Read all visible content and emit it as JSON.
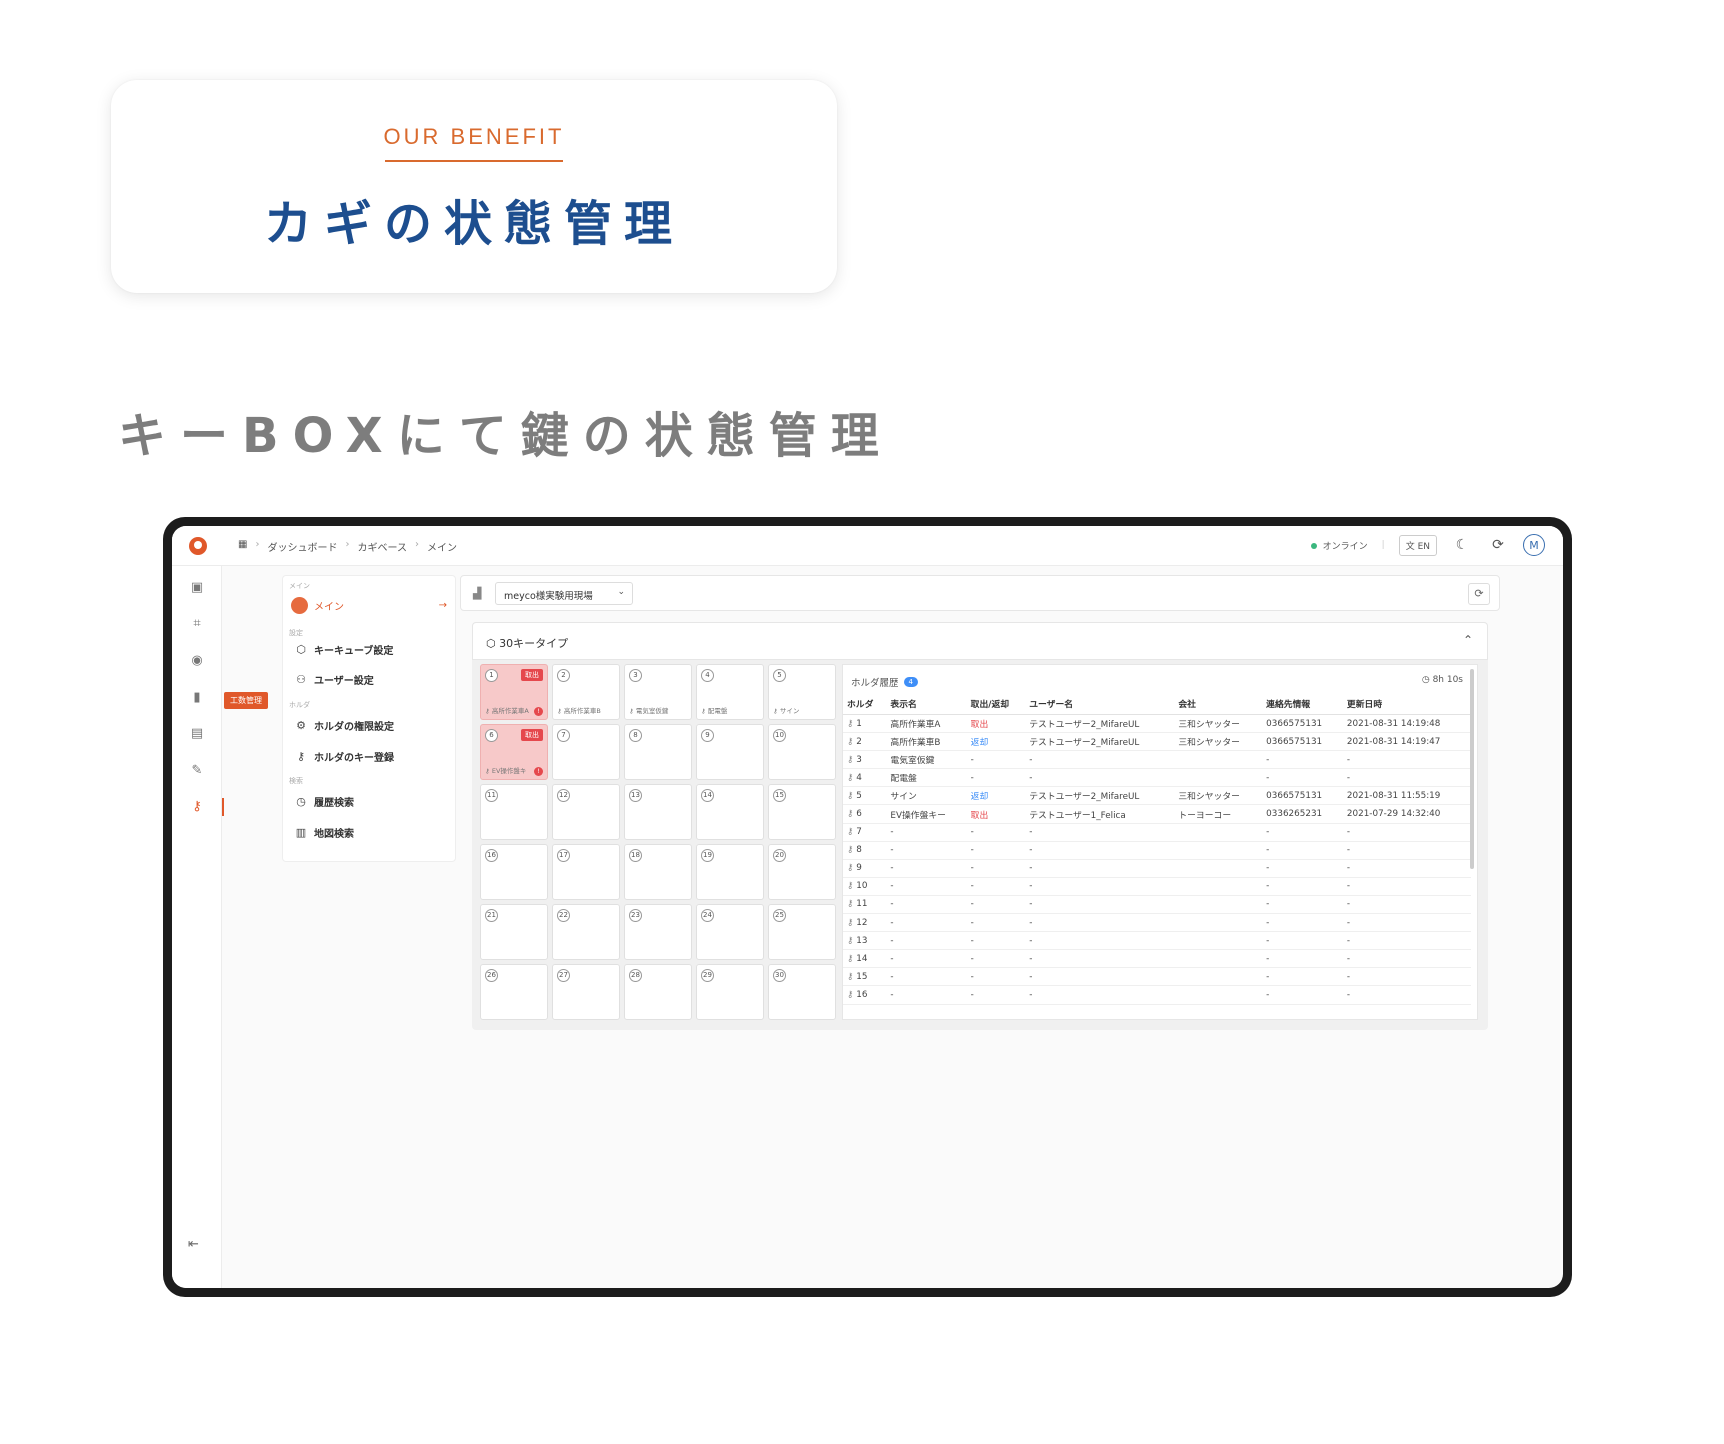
{
  "hero": {
    "eyebrow": "OUR BENEFIT",
    "title": "カギの状態管理",
    "subtitle": "キーBOXにて鍵の状態管理"
  },
  "app": {
    "breadcrumbs": [
      "ダッシュボード",
      "カギベース",
      "メイン"
    ],
    "status": "オンライン",
    "lang": "EN",
    "avatar": "M",
    "tooltip": "工数管理",
    "rail_icons": [
      "dashboard-icon",
      "scan-icon",
      "location-pin-icon",
      "bar-chart-icon",
      "archive-icon",
      "edit-icon",
      "key-icon",
      "logout-icon"
    ],
    "side_menu": {
      "section_main": "メイン",
      "main_item": "メイン",
      "section_settings": "設定",
      "section_holder": "ホルダ",
      "section_search": "検索",
      "items": [
        {
          "label": "キーキューブ設定",
          "icon": "cube-icon"
        },
        {
          "label": "ユーザー設定",
          "icon": "user-icon"
        },
        {
          "label": "ホルダの権限設定",
          "icon": "gear-icon"
        },
        {
          "label": "ホルダのキー登録",
          "icon": "key-icon"
        },
        {
          "label": "履歴検索",
          "icon": "clock-icon"
        },
        {
          "label": "地図検索",
          "icon": "map-icon"
        }
      ]
    },
    "site_select": "meyco様実験用現場",
    "panel_title": "30キータイプ",
    "keys": [
      {
        "num": "1",
        "label": "高所作業車A",
        "status": "out",
        "badge": "取出"
      },
      {
        "num": "2",
        "label": "高所作業車B",
        "status": "in",
        "badge": ""
      },
      {
        "num": "3",
        "label": "電気室仮鍵",
        "status": "in",
        "badge": ""
      },
      {
        "num": "4",
        "label": "配電盤",
        "status": "in",
        "badge": ""
      },
      {
        "num": "5",
        "label": "サイン",
        "status": "in",
        "badge": ""
      },
      {
        "num": "6",
        "label": "EV操作盤キ",
        "status": "out",
        "badge": "取出"
      },
      {
        "num": "7",
        "label": "",
        "status": "in",
        "badge": ""
      },
      {
        "num": "8",
        "label": "",
        "status": "in",
        "badge": ""
      },
      {
        "num": "9",
        "label": "",
        "status": "in",
        "badge": ""
      },
      {
        "num": "10",
        "label": "",
        "status": "in",
        "badge": ""
      },
      {
        "num": "11",
        "label": "",
        "status": "in",
        "badge": ""
      },
      {
        "num": "12",
        "label": "",
        "status": "in",
        "badge": ""
      },
      {
        "num": "13",
        "label": "",
        "status": "in",
        "badge": ""
      },
      {
        "num": "14",
        "label": "",
        "status": "in",
        "badge": ""
      },
      {
        "num": "15",
        "label": "",
        "status": "in",
        "badge": ""
      },
      {
        "num": "16",
        "label": "",
        "status": "in",
        "badge": ""
      },
      {
        "num": "17",
        "label": "",
        "status": "in",
        "badge": ""
      },
      {
        "num": "18",
        "label": "",
        "status": "in",
        "badge": ""
      },
      {
        "num": "19",
        "label": "",
        "status": "in",
        "badge": ""
      },
      {
        "num": "20",
        "label": "",
        "status": "in",
        "badge": ""
      },
      {
        "num": "21",
        "label": "",
        "status": "in",
        "badge": ""
      },
      {
        "num": "22",
        "label": "",
        "status": "in",
        "badge": ""
      },
      {
        "num": "23",
        "label": "",
        "status": "in",
        "badge": ""
      },
      {
        "num": "24",
        "label": "",
        "status": "in",
        "badge": ""
      },
      {
        "num": "25",
        "label": "",
        "status": "in",
        "badge": ""
      },
      {
        "num": "26",
        "label": "",
        "status": "in",
        "badge": ""
      },
      {
        "num": "27",
        "label": "",
        "status": "in",
        "badge": ""
      },
      {
        "num": "28",
        "label": "",
        "status": "in",
        "badge": ""
      },
      {
        "num": "29",
        "label": "",
        "status": "in",
        "badge": ""
      },
      {
        "num": "30",
        "label": "",
        "status": "in",
        "badge": ""
      }
    ],
    "holder_history": {
      "title": "ホルダ履歴",
      "count": "4",
      "timer": "8h 10s",
      "columns": [
        "ホルダ",
        "表示名",
        "取出/返却",
        "ユーザー名",
        "会社",
        "連絡先情報",
        "更新日時"
      ],
      "rows": [
        {
          "holder": "1",
          "name": "高所作業車A",
          "status": "取出",
          "status_type": "out",
          "user": "テストユーザー2_MifareUL",
          "company": "三和シヤッター",
          "contact": "0366575131",
          "updated": "2021-08-31 14:19:48"
        },
        {
          "holder": "2",
          "name": "高所作業車B",
          "status": "返却",
          "status_type": "back",
          "user": "テストユーザー2_MifareUL",
          "company": "三和シヤッター",
          "contact": "0366575131",
          "updated": "2021-08-31 14:19:47"
        },
        {
          "holder": "3",
          "name": "電気室仮鍵",
          "status": "-",
          "status_type": "",
          "user": "-",
          "company": "",
          "contact": "-",
          "updated": "-"
        },
        {
          "holder": "4",
          "name": "配電盤",
          "status": "-",
          "status_type": "",
          "user": "-",
          "company": "",
          "contact": "-",
          "updated": "-"
        },
        {
          "holder": "5",
          "name": "サイン",
          "status": "返却",
          "status_type": "back",
          "user": "テストユーザー2_MifareUL",
          "company": "三和シヤッター",
          "contact": "0366575131",
          "updated": "2021-08-31 11:55:19"
        },
        {
          "holder": "6",
          "name": "EV操作盤キー",
          "status": "取出",
          "status_type": "out",
          "user": "テストユーザー1_Felica",
          "company": "トーヨーコー",
          "contact": "0336265231",
          "updated": "2021-07-29 14:32:40"
        },
        {
          "holder": "7",
          "name": "-",
          "status": "-",
          "status_type": "",
          "user": "-",
          "company": "",
          "contact": "-",
          "updated": "-"
        },
        {
          "holder": "8",
          "name": "-",
          "status": "-",
          "status_type": "",
          "user": "-",
          "company": "",
          "contact": "-",
          "updated": "-"
        },
        {
          "holder": "9",
          "name": "-",
          "status": "-",
          "status_type": "",
          "user": "-",
          "company": "",
          "contact": "-",
          "updated": "-"
        },
        {
          "holder": "10",
          "name": "-",
          "status": "-",
          "status_type": "",
          "user": "-",
          "company": "",
          "contact": "-",
          "updated": "-"
        },
        {
          "holder": "11",
          "name": "-",
          "status": "-",
          "status_type": "",
          "user": "-",
          "company": "",
          "contact": "-",
          "updated": "-"
        },
        {
          "holder": "12",
          "name": "-",
          "status": "-",
          "status_type": "",
          "user": "-",
          "company": "",
          "contact": "-",
          "updated": "-"
        },
        {
          "holder": "13",
          "name": "-",
          "status": "-",
          "status_type": "",
          "user": "-",
          "company": "",
          "contact": "-",
          "updated": "-"
        },
        {
          "holder": "14",
          "name": "-",
          "status": "-",
          "status_type": "",
          "user": "-",
          "company": "",
          "contact": "-",
          "updated": "-"
        },
        {
          "holder": "15",
          "name": "-",
          "status": "-",
          "status_type": "",
          "user": "-",
          "company": "",
          "contact": "-",
          "updated": "-"
        },
        {
          "holder": "16",
          "name": "-",
          "status": "-",
          "status_type": "",
          "user": "-",
          "company": "",
          "contact": "-",
          "updated": "-"
        }
      ]
    }
  },
  "colors": {
    "accent": "#e0582a",
    "title_blue": "#1d4e8f",
    "out_red": "#e5484d",
    "back_blue": "#3e8ef7"
  }
}
